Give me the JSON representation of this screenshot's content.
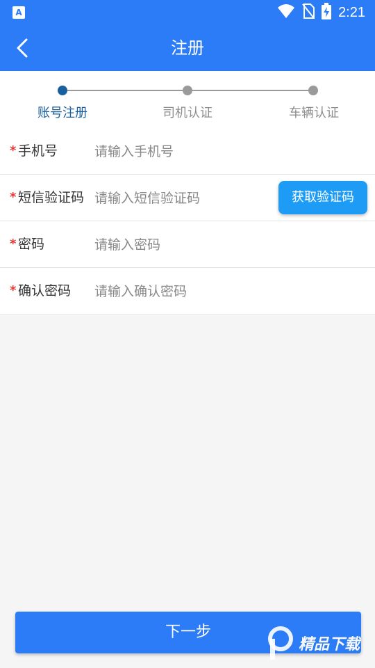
{
  "status_bar": {
    "time": "2:21",
    "left_icon_letter": "A",
    "icons": [
      "wifi-icon",
      "no-sim-icon",
      "battery-charging-icon"
    ]
  },
  "nav": {
    "title": "注册",
    "back_icon": "chevron-left-icon"
  },
  "steps": [
    {
      "label": "账号注册",
      "active": true
    },
    {
      "label": "司机认证",
      "active": false
    },
    {
      "label": "车辆认证",
      "active": false
    }
  ],
  "form": {
    "required_mark": "*",
    "phone": {
      "label": "手机号",
      "placeholder": "请输入手机号",
      "value": ""
    },
    "sms_code": {
      "label": "短信验证码",
      "placeholder": "请输入短信验证码",
      "value": "",
      "button_label": "获取验证码"
    },
    "password": {
      "label": "密码",
      "placeholder": "请输入密码",
      "value": ""
    },
    "confirm_password": {
      "label": "确认密码",
      "placeholder": "请输入确认密码",
      "value": ""
    }
  },
  "next_button_label": "下一步",
  "watermark_text": "精品下载",
  "colors": {
    "primary": "#2b7cf6",
    "code_button": "#1e9bf5",
    "step_active": "#1a5f9e",
    "step_inactive": "#8e8e8e",
    "required": "#e53935"
  }
}
